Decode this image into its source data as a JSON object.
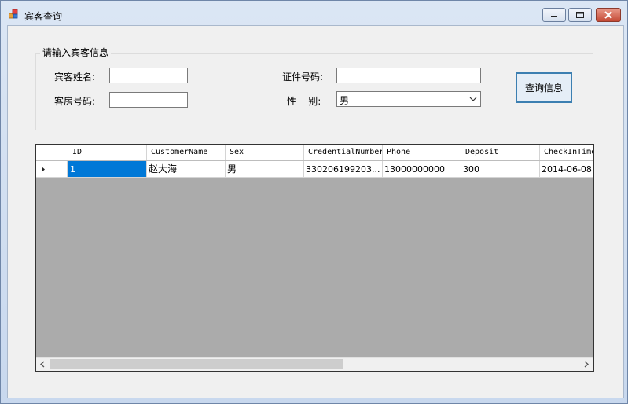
{
  "window": {
    "title": "宾客查询"
  },
  "group": {
    "legend": "请输入宾客信息"
  },
  "form": {
    "name_label": "宾客姓名:",
    "name_value": "",
    "room_label": "客房号码:",
    "room_value": "",
    "credential_label": "证件号码:",
    "credential_value": "",
    "gender_label": "性    别:",
    "gender_value": "男"
  },
  "query_button": "查询信息",
  "grid": {
    "columns": [
      "ID",
      "CustomerName",
      "Sex",
      "CredentialNumber",
      "Phone",
      "Deposit",
      "CheckInTime"
    ],
    "rows": [
      [
        "1",
        "赵大海",
        "男",
        "330206199203...",
        "13000000000",
        "300",
        "2014-06-08"
      ]
    ]
  }
}
